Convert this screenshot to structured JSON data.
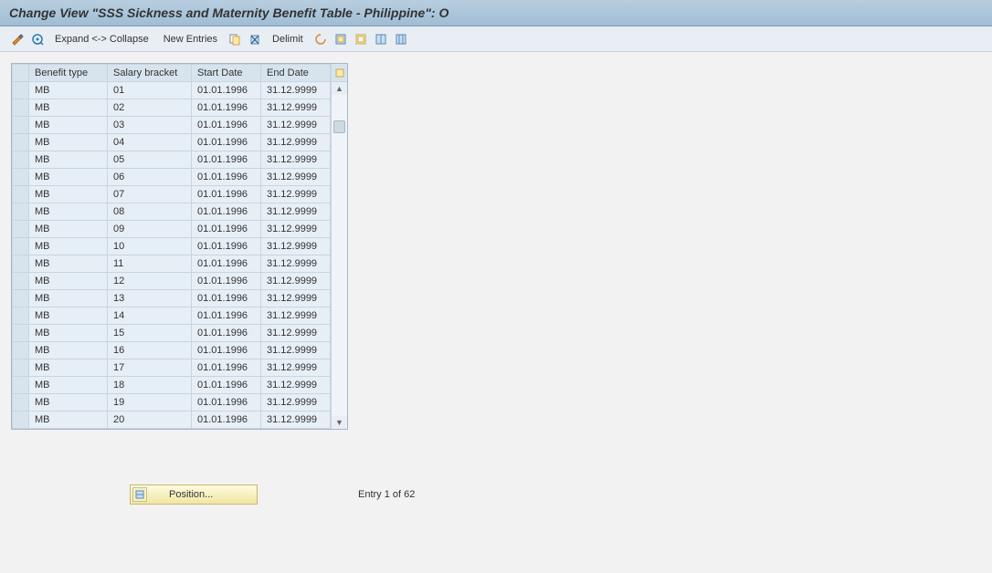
{
  "title": "Change View \"SSS Sickness and Maternity Benefit Table - Philippine\": O",
  "toolbar": {
    "expand_collapse": "Expand <-> Collapse",
    "new_entries": "New Entries",
    "delimit": "Delimit"
  },
  "columns": [
    "Benefit type",
    "Salary bracket",
    "Start Date",
    "End Date"
  ],
  "rows": [
    {
      "benefit": "MB",
      "bracket": "01",
      "start": "01.01.1996",
      "end": "31.12.9999"
    },
    {
      "benefit": "MB",
      "bracket": "02",
      "start": "01.01.1996",
      "end": "31.12.9999"
    },
    {
      "benefit": "MB",
      "bracket": "03",
      "start": "01.01.1996",
      "end": "31.12.9999"
    },
    {
      "benefit": "MB",
      "bracket": "04",
      "start": "01.01.1996",
      "end": "31.12.9999"
    },
    {
      "benefit": "MB",
      "bracket": "05",
      "start": "01.01.1996",
      "end": "31.12.9999"
    },
    {
      "benefit": "MB",
      "bracket": "06",
      "start": "01.01.1996",
      "end": "31.12.9999"
    },
    {
      "benefit": "MB",
      "bracket": "07",
      "start": "01.01.1996",
      "end": "31.12.9999"
    },
    {
      "benefit": "MB",
      "bracket": "08",
      "start": "01.01.1996",
      "end": "31.12.9999"
    },
    {
      "benefit": "MB",
      "bracket": "09",
      "start": "01.01.1996",
      "end": "31.12.9999"
    },
    {
      "benefit": "MB",
      "bracket": "10",
      "start": "01.01.1996",
      "end": "31.12.9999"
    },
    {
      "benefit": "MB",
      "bracket": "11",
      "start": "01.01.1996",
      "end": "31.12.9999"
    },
    {
      "benefit": "MB",
      "bracket": "12",
      "start": "01.01.1996",
      "end": "31.12.9999"
    },
    {
      "benefit": "MB",
      "bracket": "13",
      "start": "01.01.1996",
      "end": "31.12.9999"
    },
    {
      "benefit": "MB",
      "bracket": "14",
      "start": "01.01.1996",
      "end": "31.12.9999"
    },
    {
      "benefit": "MB",
      "bracket": "15",
      "start": "01.01.1996",
      "end": "31.12.9999"
    },
    {
      "benefit": "MB",
      "bracket": "16",
      "start": "01.01.1996",
      "end": "31.12.9999"
    },
    {
      "benefit": "MB",
      "bracket": "17",
      "start": "01.01.1996",
      "end": "31.12.9999"
    },
    {
      "benefit": "MB",
      "bracket": "18",
      "start": "01.01.1996",
      "end": "31.12.9999"
    },
    {
      "benefit": "MB",
      "bracket": "19",
      "start": "01.01.1996",
      "end": "31.12.9999"
    },
    {
      "benefit": "MB",
      "bracket": "20",
      "start": "01.01.1996",
      "end": "31.12.9999"
    }
  ],
  "footer": {
    "position_label": "Position...",
    "entry_text": "Entry 1 of 62"
  }
}
